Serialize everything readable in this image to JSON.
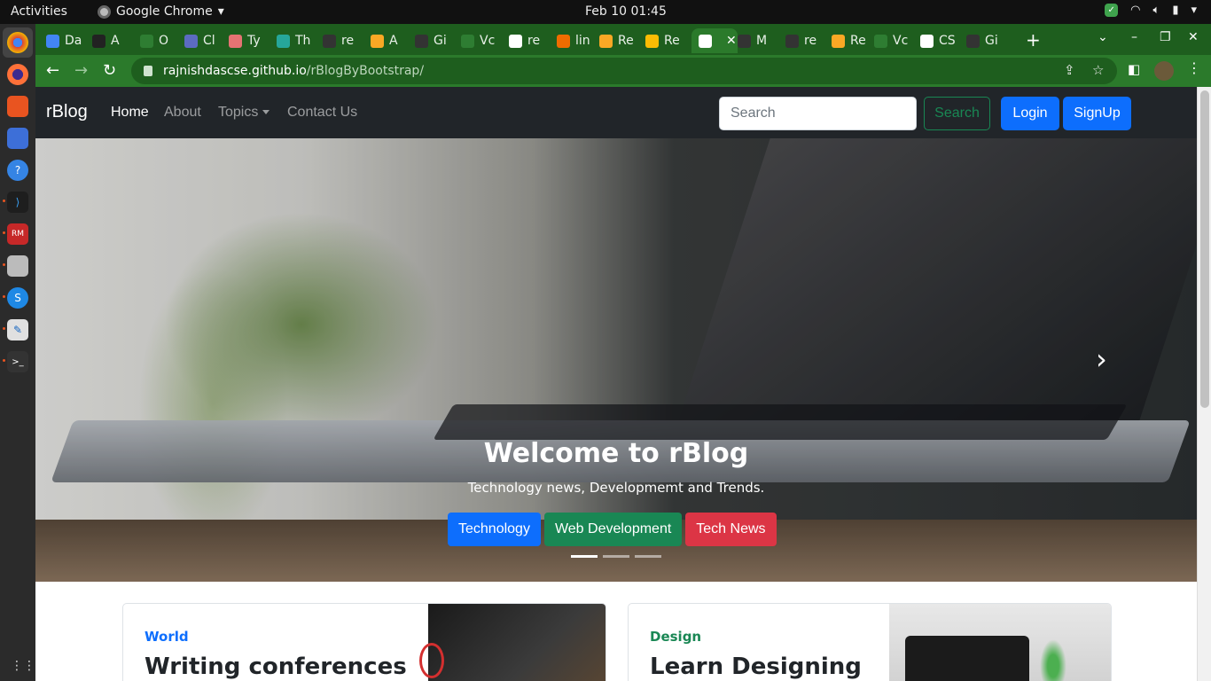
{
  "topbar": {
    "activities": "Activities",
    "app_name": "Google Chrome",
    "clock": "Feb 10  01:45"
  },
  "tabs": [
    {
      "label": "Da",
      "color": "#4285f4"
    },
    {
      "label": "A",
      "color": "#222222"
    },
    {
      "label": "O",
      "color": "#2e7d32"
    },
    {
      "label": "Cl",
      "color": "#5c6bc0"
    },
    {
      "label": "Ty",
      "color": "#e57373"
    },
    {
      "label": "Th",
      "color": "#26a69a"
    },
    {
      "label": "re",
      "color": "#333333"
    },
    {
      "label": "A",
      "color": "#f9a825"
    },
    {
      "label": "Gi",
      "color": "#333333"
    },
    {
      "label": "Vc",
      "color": "#2e7d32"
    },
    {
      "label": "re",
      "color": "#ffffff"
    },
    {
      "label": "lin",
      "color": "#ef6c00"
    },
    {
      "label": "Re",
      "color": "#f9a825"
    },
    {
      "label": "Re",
      "color": "#fbbc04"
    },
    {
      "label": "",
      "color": "#ffffff"
    },
    {
      "label": "M",
      "color": "#333333"
    },
    {
      "label": "re",
      "color": "#333333"
    },
    {
      "label": "Re",
      "color": "#f9a825"
    },
    {
      "label": "Vc",
      "color": "#2e7d32"
    },
    {
      "label": "CS",
      "color": "#ffffff"
    },
    {
      "label": "Gi",
      "color": "#333333"
    }
  ],
  "omnibox": {
    "host": "rajnishdascse.github.io",
    "path": "/rBlogByBootstrap/"
  },
  "page": {
    "brand": "rBlog",
    "nav": {
      "home": "Home",
      "about": "About",
      "topics": "Topics",
      "contact": "Contact Us"
    },
    "search_placeholder": "Search",
    "search_button": "Search",
    "login_button": "Login",
    "signup_button": "SignUp",
    "carousel": {
      "title": "Welcome to rBlog",
      "subtitle": "Technology news, Developmemt and Trends.",
      "buttons": [
        "Technology",
        "Web Development",
        "Tech News"
      ],
      "active_slide": 1,
      "slide_count": 3
    },
    "cards": [
      {
        "category": "World",
        "category_color": "#0d6efd",
        "title": "Writing conferences"
      },
      {
        "category": "Design",
        "category_color": "#198754",
        "title": "Learn Designing"
      }
    ]
  },
  "colors": {
    "chrome_theme": "#2b7a2b",
    "navbar": "#212529",
    "primary": "#0d6efd",
    "success": "#198754",
    "danger": "#dc3545"
  }
}
